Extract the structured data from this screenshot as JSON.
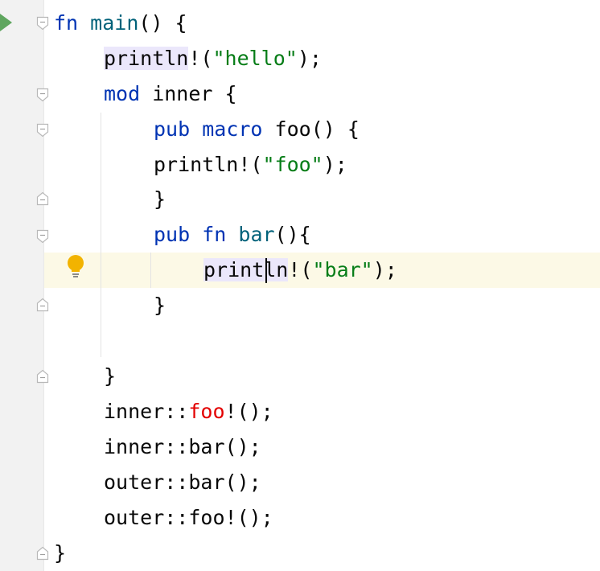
{
  "editor": {
    "lines": [
      {
        "tokens": [
          {
            "t": "fn",
            "c": "kw"
          },
          {
            "t": " ",
            "c": ""
          },
          {
            "t": "main",
            "c": "fn"
          },
          {
            "t": "() {",
            "c": ""
          }
        ]
      },
      {
        "tokens": [
          {
            "t": "println",
            "c": "hl"
          },
          {
            "t": "!(",
            "c": ""
          },
          {
            "t": "\"hello\"",
            "c": "str"
          },
          {
            "t": ");",
            "c": ""
          }
        ]
      },
      {
        "tokens": [
          {
            "t": "mod",
            "c": "kw"
          },
          {
            "t": " inner {",
            "c": ""
          }
        ]
      },
      {
        "tokens": [
          {
            "t": "pub",
            "c": "kw"
          },
          {
            "t": " ",
            "c": ""
          },
          {
            "t": "macro",
            "c": "kw"
          },
          {
            "t": " foo() {",
            "c": ""
          }
        ]
      },
      {
        "tokens": [
          {
            "t": "println!(",
            "c": ""
          },
          {
            "t": "\"foo\"",
            "c": "str"
          },
          {
            "t": ");",
            "c": ""
          }
        ]
      },
      {
        "tokens": [
          {
            "t": "}",
            "c": ""
          }
        ]
      },
      {
        "tokens": [
          {
            "t": "pub",
            "c": "kw"
          },
          {
            "t": " ",
            "c": ""
          },
          {
            "t": "fn",
            "c": "kw"
          },
          {
            "t": " ",
            "c": ""
          },
          {
            "t": "bar",
            "c": "fn"
          },
          {
            "t": "(){",
            "c": ""
          }
        ]
      },
      {
        "tokens": [
          {
            "t": "println",
            "c": "hl"
          },
          {
            "t": "!(",
            "c": ""
          },
          {
            "t": "\"bar\"",
            "c": "str"
          },
          {
            "t": ");",
            "c": ""
          }
        ]
      },
      {
        "tokens": [
          {
            "t": "}",
            "c": ""
          }
        ]
      },
      {
        "tokens": []
      },
      {
        "tokens": [
          {
            "t": "}",
            "c": ""
          }
        ]
      },
      {
        "tokens": [
          {
            "t": "inner::",
            "c": ""
          },
          {
            "t": "foo",
            "c": "err"
          },
          {
            "t": "!();",
            "c": ""
          }
        ]
      },
      {
        "tokens": [
          {
            "t": "inner::bar();",
            "c": ""
          }
        ]
      },
      {
        "tokens": [
          {
            "t": "outer::bar();",
            "c": ""
          }
        ]
      },
      {
        "tokens": [
          {
            "t": "outer::foo!();",
            "c": ""
          }
        ]
      },
      {
        "tokens": [
          {
            "t": "}",
            "c": ""
          }
        ]
      }
    ]
  },
  "gutter": {
    "run_icon": "run-triangle-icon",
    "intention_icon": "lightbulb-icon",
    "fold_markers": [
      "fold-open-icon",
      "fold-close-icon"
    ]
  },
  "colors": {
    "keyword": "#0033b3",
    "function": "#00627a",
    "string": "#067d17",
    "error": "#e30000",
    "usage_highlight": "#ebe7fb",
    "current_line": "#fcf9e6",
    "run_icon": "#5fa65f",
    "bulb": "#f2b300"
  }
}
